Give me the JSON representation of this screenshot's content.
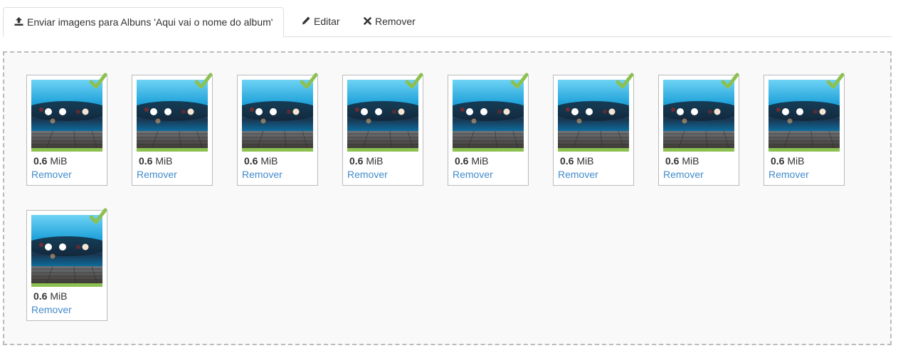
{
  "tabs": [
    {
      "label": "Enviar imagens para Albuns 'Aqui vai o nome do album'",
      "icon": "upload-icon",
      "active": true
    },
    {
      "label": "Editar",
      "icon": "pencil-icon",
      "active": false
    },
    {
      "label": "Remover",
      "icon": "close-icon",
      "active": false
    }
  ],
  "uploads": [
    {
      "size_value": "0.6",
      "size_unit": "MiB",
      "remove_label": "Remover",
      "status": "uploaded"
    },
    {
      "size_value": "0.6",
      "size_unit": "MiB",
      "remove_label": "Remover",
      "status": "uploaded"
    },
    {
      "size_value": "0.6",
      "size_unit": "MiB",
      "remove_label": "Remover",
      "status": "uploaded"
    },
    {
      "size_value": "0.6",
      "size_unit": "MiB",
      "remove_label": "Remover",
      "status": "uploaded"
    },
    {
      "size_value": "0.6",
      "size_unit": "MiB",
      "remove_label": "Remover",
      "status": "uploaded"
    },
    {
      "size_value": "0.6",
      "size_unit": "MiB",
      "remove_label": "Remover",
      "status": "uploaded"
    },
    {
      "size_value": "0.6",
      "size_unit": "MiB",
      "remove_label": "Remover",
      "status": "uploaded"
    },
    {
      "size_value": "0.6",
      "size_unit": "MiB",
      "remove_label": "Remover",
      "status": "uploaded"
    },
    {
      "size_value": "0.6",
      "size_unit": "MiB",
      "remove_label": "Remover",
      "status": "uploaded"
    }
  ],
  "colors": {
    "link": "#428bca",
    "success": "#8cc152",
    "progress_bar": "#8cc152"
  }
}
